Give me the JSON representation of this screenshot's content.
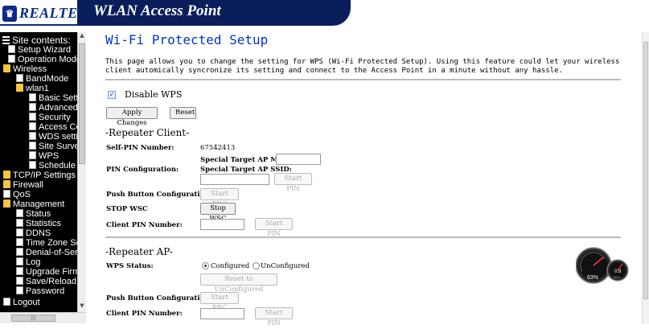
{
  "header": {
    "logo_text": "REALTEK",
    "banner_title": "WLAN Access Point"
  },
  "sidebar": {
    "root": "Site contents:",
    "items": [
      {
        "label": "Setup Wizard",
        "icon": "doc"
      },
      {
        "label": "Operation Mode",
        "icon": "doc"
      },
      {
        "label": "Wireless",
        "icon": "folder"
      },
      {
        "label": "BandMode",
        "icon": "doc"
      },
      {
        "label": "wlan1",
        "icon": "folder"
      },
      {
        "label": "Basic Settings",
        "icon": "doc"
      },
      {
        "label": "Advanced Set",
        "icon": "doc"
      },
      {
        "label": "Security",
        "icon": "doc"
      },
      {
        "label": "Access Contro",
        "icon": "doc"
      },
      {
        "label": "WDS settings",
        "icon": "doc"
      },
      {
        "label": "Site Survey",
        "icon": "doc"
      },
      {
        "label": "WPS",
        "icon": "doc"
      },
      {
        "label": "Schedule",
        "icon": "doc"
      },
      {
        "label": "TCP/IP Settings",
        "icon": "folder"
      },
      {
        "label": "Firewall",
        "icon": "folder"
      },
      {
        "label": "QoS",
        "icon": "doc"
      },
      {
        "label": "Management",
        "icon": "folder"
      },
      {
        "label": "Status",
        "icon": "doc"
      },
      {
        "label": "Statistics",
        "icon": "doc"
      },
      {
        "label": "DDNS",
        "icon": "doc"
      },
      {
        "label": "Time Zone Settin",
        "icon": "doc"
      },
      {
        "label": "Denial-of-Service",
        "icon": "doc"
      },
      {
        "label": "Log",
        "icon": "doc"
      },
      {
        "label": "Upgrade Firmwa",
        "icon": "doc"
      },
      {
        "label": "Save/Reload Set",
        "icon": "doc"
      },
      {
        "label": "Password",
        "icon": "doc"
      },
      {
        "label": "Logout",
        "icon": "doc"
      }
    ]
  },
  "main": {
    "title": "Wi-Fi Protected Setup",
    "intro": "This page allows you to change the setting for WPS (Wi-Fi Protected Setup). Using this feature could let your wireless client automically syncronize its setting and connect to the Access Point in a minute without any hassle.",
    "disable_wps_label": "Disable WPS",
    "disable_wps_checked": true,
    "apply_button": "Apply Changes",
    "reset_button": "Reset",
    "repeater_client": {
      "heading": "-Repeater Client-",
      "self_pin_label": "Self-PIN Number:",
      "self_pin_value": "67542413",
      "pin_config_label": "PIN Configuration:",
      "target_mac_label": "Special Target AP MAC:",
      "target_ssid_label": "Special Target AP SSID:",
      "start_pin_button": "Start PIN",
      "push_button_label": "Push Button Configuration:",
      "start_pbc_button": "Start PBC",
      "stop_wsc_label": "STOP WSC",
      "stop_wsc_button": "Stop WSC",
      "client_pin_label": "Client PIN Number:",
      "client_start_pin_button": "Start PIN"
    },
    "repeater_ap": {
      "heading": "-Repeater AP-",
      "wps_status_label": "WPS Status:",
      "configured_label": "Configured",
      "unconfigured_label": "UnConfigured",
      "status_selected": "Configured",
      "reset_unconfigured_button": "Reset to UnConfigured",
      "push_button_label": "Push Button Configuration:",
      "start_pbc_button": "Start PBC",
      "client_pin_label": "Client PIN Number:",
      "start_pin_button": "Start PIN"
    }
  },
  "gauge": {
    "percent": "63%",
    "small_value": "0.8",
    "small_unit": "KB/S"
  }
}
